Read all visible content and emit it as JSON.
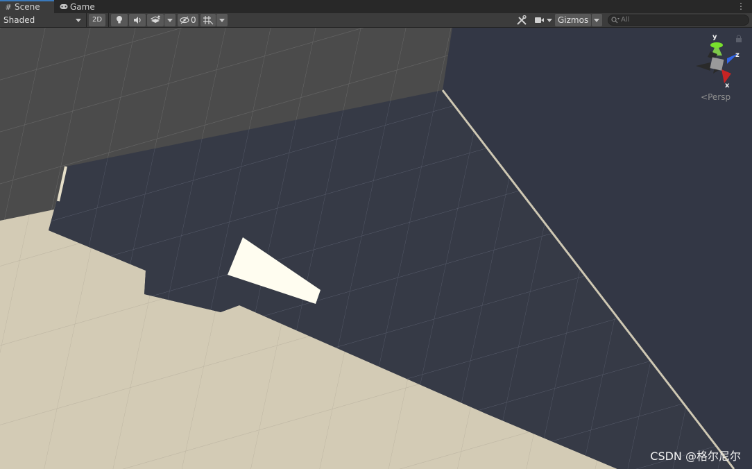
{
  "tabs": [
    {
      "label": "Scene",
      "icon": "grid-icon",
      "active": true
    },
    {
      "label": "Game",
      "icon": "gamepad-icon",
      "active": false
    }
  ],
  "toolbar": {
    "draw_mode": "Shaded",
    "mode_2d": "2D",
    "hidden_count": "0",
    "gizmos": "Gizmos",
    "search_placeholder": "All"
  },
  "gizmo": {
    "y": "y",
    "z": "z",
    "x": "x",
    "projection": "Persp"
  },
  "watermark": "CSDN @格尔尼尔",
  "colors": {
    "toolbar": "#3c3c3c",
    "tab_accent": "#3a79bb",
    "background": "#333745",
    "floor_lit": "#d3cbb5",
    "floor_shadow": "#4b4b4b",
    "wall": "#363a46",
    "quad": "#fffdf0"
  }
}
